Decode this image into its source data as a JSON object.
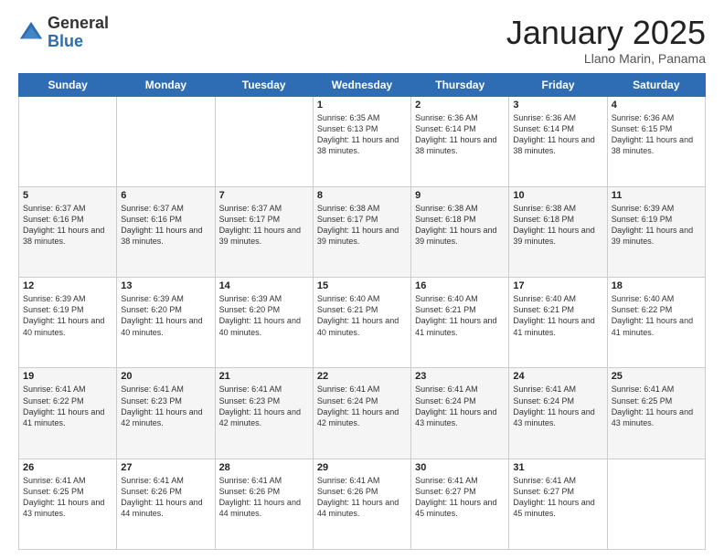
{
  "logo": {
    "general": "General",
    "blue": "Blue"
  },
  "title": {
    "month": "January 2025",
    "location": "Llano Marin, Panama"
  },
  "days_of_week": [
    "Sunday",
    "Monday",
    "Tuesday",
    "Wednesday",
    "Thursday",
    "Friday",
    "Saturday"
  ],
  "weeks": [
    [
      {
        "day": "",
        "info": ""
      },
      {
        "day": "",
        "info": ""
      },
      {
        "day": "",
        "info": ""
      },
      {
        "day": "1",
        "info": "Sunrise: 6:35 AM\nSunset: 6:13 PM\nDaylight: 11 hours\nand 38 minutes."
      },
      {
        "day": "2",
        "info": "Sunrise: 6:36 AM\nSunset: 6:14 PM\nDaylight: 11 hours\nand 38 minutes."
      },
      {
        "day": "3",
        "info": "Sunrise: 6:36 AM\nSunset: 6:14 PM\nDaylight: 11 hours\nand 38 minutes."
      },
      {
        "day": "4",
        "info": "Sunrise: 6:36 AM\nSunset: 6:15 PM\nDaylight: 11 hours\nand 38 minutes."
      }
    ],
    [
      {
        "day": "5",
        "info": "Sunrise: 6:37 AM\nSunset: 6:16 PM\nDaylight: 11 hours\nand 38 minutes."
      },
      {
        "day": "6",
        "info": "Sunrise: 6:37 AM\nSunset: 6:16 PM\nDaylight: 11 hours\nand 38 minutes."
      },
      {
        "day": "7",
        "info": "Sunrise: 6:37 AM\nSunset: 6:17 PM\nDaylight: 11 hours\nand 39 minutes."
      },
      {
        "day": "8",
        "info": "Sunrise: 6:38 AM\nSunset: 6:17 PM\nDaylight: 11 hours\nand 39 minutes."
      },
      {
        "day": "9",
        "info": "Sunrise: 6:38 AM\nSunset: 6:18 PM\nDaylight: 11 hours\nand 39 minutes."
      },
      {
        "day": "10",
        "info": "Sunrise: 6:38 AM\nSunset: 6:18 PM\nDaylight: 11 hours\nand 39 minutes."
      },
      {
        "day": "11",
        "info": "Sunrise: 6:39 AM\nSunset: 6:19 PM\nDaylight: 11 hours\nand 39 minutes."
      }
    ],
    [
      {
        "day": "12",
        "info": "Sunrise: 6:39 AM\nSunset: 6:19 PM\nDaylight: 11 hours\nand 40 minutes."
      },
      {
        "day": "13",
        "info": "Sunrise: 6:39 AM\nSunset: 6:20 PM\nDaylight: 11 hours\nand 40 minutes."
      },
      {
        "day": "14",
        "info": "Sunrise: 6:39 AM\nSunset: 6:20 PM\nDaylight: 11 hours\nand 40 minutes."
      },
      {
        "day": "15",
        "info": "Sunrise: 6:40 AM\nSunset: 6:21 PM\nDaylight: 11 hours\nand 40 minutes."
      },
      {
        "day": "16",
        "info": "Sunrise: 6:40 AM\nSunset: 6:21 PM\nDaylight: 11 hours\nand 41 minutes."
      },
      {
        "day": "17",
        "info": "Sunrise: 6:40 AM\nSunset: 6:21 PM\nDaylight: 11 hours\nand 41 minutes."
      },
      {
        "day": "18",
        "info": "Sunrise: 6:40 AM\nSunset: 6:22 PM\nDaylight: 11 hours\nand 41 minutes."
      }
    ],
    [
      {
        "day": "19",
        "info": "Sunrise: 6:41 AM\nSunset: 6:22 PM\nDaylight: 11 hours\nand 41 minutes."
      },
      {
        "day": "20",
        "info": "Sunrise: 6:41 AM\nSunset: 6:23 PM\nDaylight: 11 hours\nand 42 minutes."
      },
      {
        "day": "21",
        "info": "Sunrise: 6:41 AM\nSunset: 6:23 PM\nDaylight: 11 hours\nand 42 minutes."
      },
      {
        "day": "22",
        "info": "Sunrise: 6:41 AM\nSunset: 6:24 PM\nDaylight: 11 hours\nand 42 minutes."
      },
      {
        "day": "23",
        "info": "Sunrise: 6:41 AM\nSunset: 6:24 PM\nDaylight: 11 hours\nand 43 minutes."
      },
      {
        "day": "24",
        "info": "Sunrise: 6:41 AM\nSunset: 6:24 PM\nDaylight: 11 hours\nand 43 minutes."
      },
      {
        "day": "25",
        "info": "Sunrise: 6:41 AM\nSunset: 6:25 PM\nDaylight: 11 hours\nand 43 minutes."
      }
    ],
    [
      {
        "day": "26",
        "info": "Sunrise: 6:41 AM\nSunset: 6:25 PM\nDaylight: 11 hours\nand 43 minutes."
      },
      {
        "day": "27",
        "info": "Sunrise: 6:41 AM\nSunset: 6:26 PM\nDaylight: 11 hours\nand 44 minutes."
      },
      {
        "day": "28",
        "info": "Sunrise: 6:41 AM\nSunset: 6:26 PM\nDaylight: 11 hours\nand 44 minutes."
      },
      {
        "day": "29",
        "info": "Sunrise: 6:41 AM\nSunset: 6:26 PM\nDaylight: 11 hours\nand 44 minutes."
      },
      {
        "day": "30",
        "info": "Sunrise: 6:41 AM\nSunset: 6:27 PM\nDaylight: 11 hours\nand 45 minutes."
      },
      {
        "day": "31",
        "info": "Sunrise: 6:41 AM\nSunset: 6:27 PM\nDaylight: 11 hours\nand 45 minutes."
      },
      {
        "day": "",
        "info": ""
      }
    ]
  ]
}
